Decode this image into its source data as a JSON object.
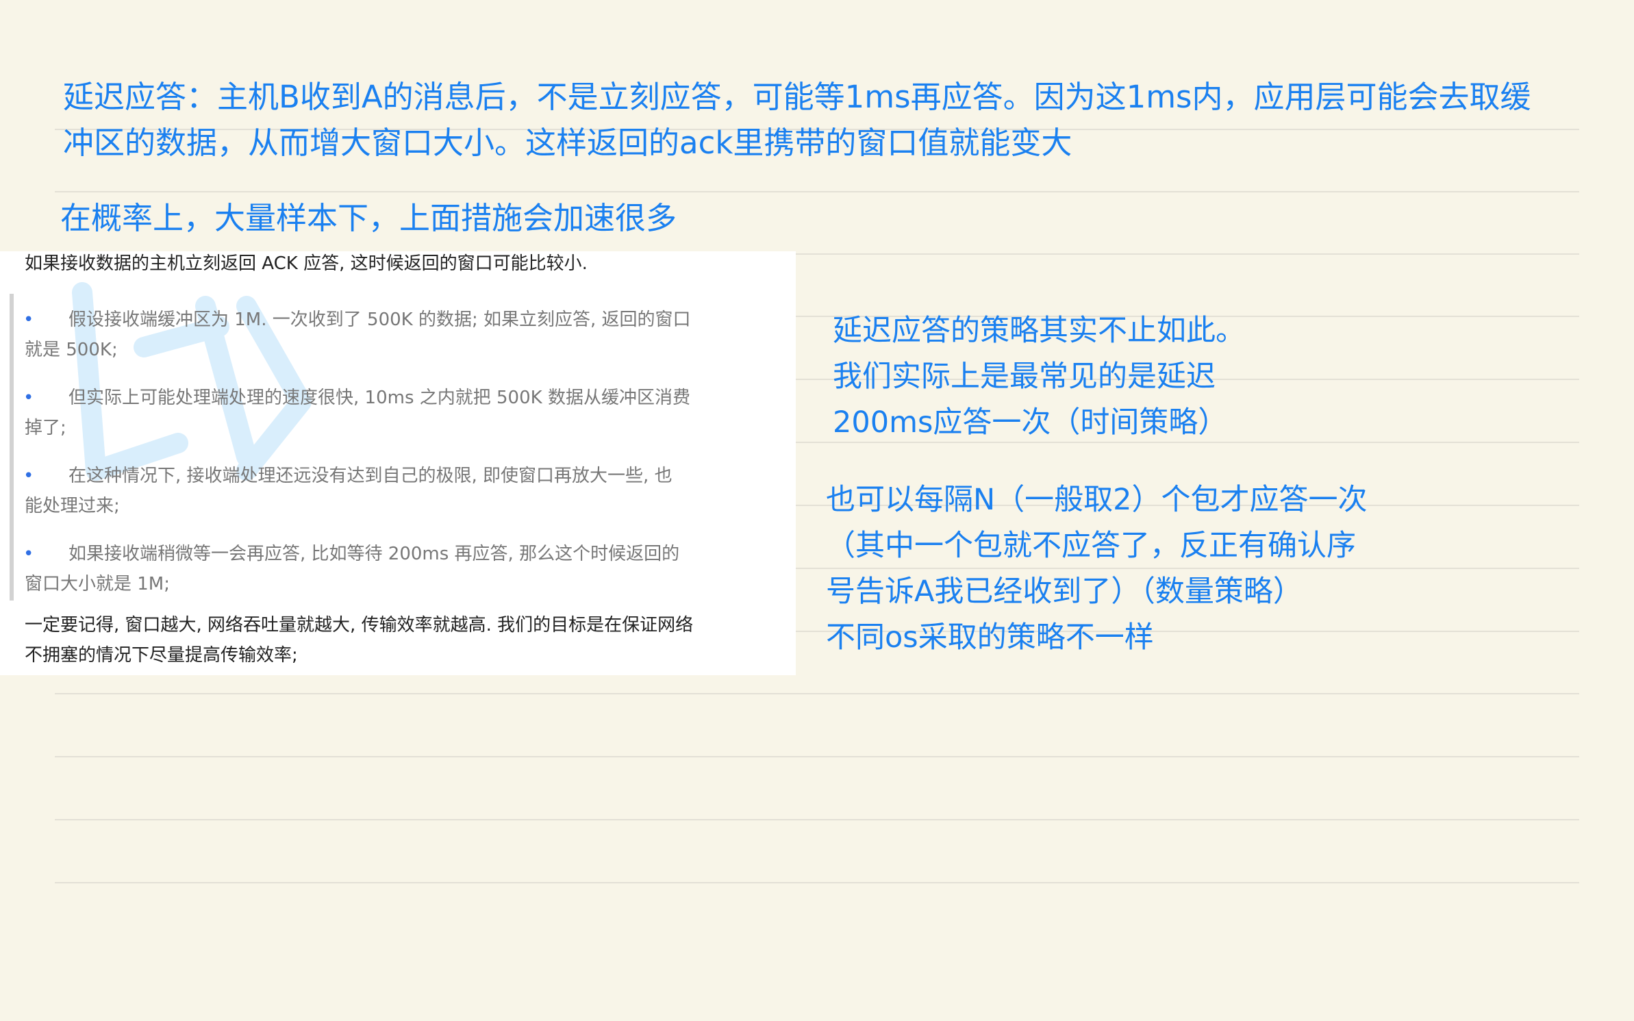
{
  "notes": {
    "top_line1": "延迟应答：主机B收到A的消息后，不是立刻应答，可能等1ms再应答。因为这1ms内，应用层可能会去取缓",
    "top_line2": "冲区的数据，从而增大窗口大小。这样返回的ack里携带的窗口值就能变大",
    "middle": "在概率上，大量样本下，上面措施会加速很多",
    "right_block1": [
      "延迟应答的策略其实不止如此。",
      "我们实际上是最常见的是延迟",
      "200ms应答一次（时间策略）"
    ],
    "right_block2": [
      "也可以每隔N（一般取2）个包才应答一次",
      "（其中一个包就不应答了，反正有确认序",
      "号告诉A我已经收到了）（数量策略）",
      "不同os采取的策略不一样"
    ],
    "accent_color": "#1a80f0"
  },
  "screenshot": {
    "intro": "如果接收数据的主机立刻返回 ACK 应答, 这时候返回的窗口可能比较小.",
    "bullets": [
      {
        "line1": "假设接收端缓冲区为 1M. 一次收到了 500K 的数据; 如果立刻应答, 返回的窗口",
        "line2": "就是 500K;"
      },
      {
        "line1": "但实际上可能处理端处理的速度很快, 10ms 之内就把 500K 数据从缓冲区消费",
        "line2": "掉了;"
      },
      {
        "line1": "在这种情况下, 接收端处理还远没有达到自己的极限, 即使窗口再放大一些, 也",
        "line2": "能处理过来;"
      },
      {
        "line1": "如果接收端稍微等一会再应答, 比如等待 200ms 再应答, 那么这个时候返回的",
        "line2": "窗口大小就是 1M;"
      }
    ],
    "bullet_symbol": "•",
    "outro_line1": "一定要记得, 窗口越大, 网络吞吐量就越大, 传输效率就越高. 我们的目标是在保证网络",
    "outro_line2": "不拥塞的情况下尽量提高传输效率;",
    "watermark_color": "#d9eefc"
  },
  "page": {
    "background": "#f8f5e8",
    "rule_color": "#e3e0d6"
  }
}
